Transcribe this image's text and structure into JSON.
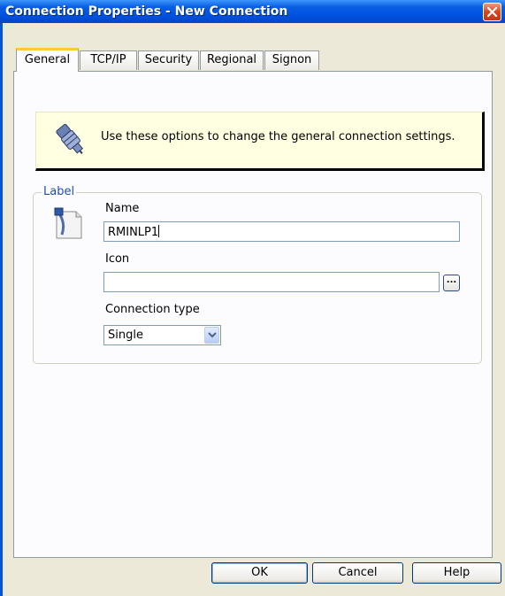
{
  "window": {
    "title": "Connection Properties - New Connection"
  },
  "tabs": [
    {
      "label": "General",
      "active": true
    },
    {
      "label": "TCP/IP",
      "active": false
    },
    {
      "label": "Security",
      "active": false
    },
    {
      "label": "Regional",
      "active": false
    },
    {
      "label": "Signon",
      "active": false
    }
  ],
  "info": {
    "text": "Use these options to change the general connection settings.",
    "icon": "connector-plug-icon"
  },
  "label_group": {
    "title": "Label",
    "icon": "document-label-icon",
    "name_label": "Name",
    "name_value": "RMINLP1",
    "icon_label": "Icon",
    "icon_value": "",
    "browse_label": "...",
    "type_label": "Connection type",
    "type_value": "Single"
  },
  "buttons": {
    "ok": "OK",
    "cancel": "Cancel",
    "help": "Help"
  },
  "colors": {
    "titlebar": "#0054e3",
    "dialog": "#ece9d8",
    "tab_highlight": "#ffc83c",
    "group_label": "#1e4ec4",
    "info_bg": "#ffffe1"
  }
}
